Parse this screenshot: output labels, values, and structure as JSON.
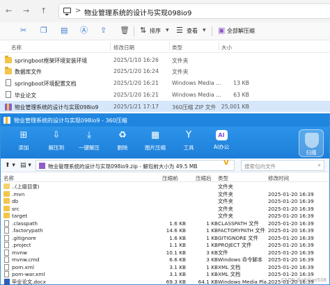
{
  "explorer": {
    "address": {
      "separator": ">",
      "crumb": "物业管理系统的设计与实现098io9"
    },
    "toolbar": {
      "sort_label": "排序",
      "view_label": "查看",
      "extract_all_label": "全部解压缩",
      "icons": [
        "cut-icon",
        "copy-icon",
        "paste-icon",
        "rename-icon",
        "share-icon",
        "delete-icon"
      ]
    },
    "columns": {
      "name": "名称",
      "date": "修改日期",
      "type": "类型",
      "size": "大小"
    },
    "rows": [
      {
        "icon": "folder",
        "name": "springboot框架环境安装环境",
        "date": "2025/1/10 16:26",
        "type": "文件夹",
        "size": ""
      },
      {
        "icon": "folder",
        "name": "数据库文件",
        "date": "2025/1/20 16:24",
        "type": "文件夹",
        "size": ""
      },
      {
        "icon": "doc",
        "name": "springboot环境配置文档",
        "date": "2025/1/20 16:21",
        "type": "Windows Media ...",
        "size": "13 KB"
      },
      {
        "icon": "doc",
        "name": "毕业论文",
        "date": "2025/1/20 16:21",
        "type": "Windows Media ...",
        "size": "63 KB"
      },
      {
        "icon": "zip",
        "name": "物业管理系统的设计与实现098io9",
        "date": "2025/1/21 17:17",
        "type": "360压缩 ZIP 文件",
        "size": "25,001 KB",
        "selected": true
      }
    ]
  },
  "zip": {
    "title": "物业管理系统的设计与实现098io9 - 360压缩",
    "ribbon": [
      {
        "label": "添加",
        "icon": "add-icon"
      },
      {
        "label": "解压到",
        "icon": "extract-to-icon"
      },
      {
        "label": "一键解压",
        "icon": "one-click-extract-icon"
      },
      {
        "label": "删除",
        "icon": "delete-icon"
      },
      {
        "label": "图片压缩",
        "icon": "image-compress-icon"
      },
      {
        "label": "工具",
        "icon": "tools-icon"
      },
      {
        "label": "AI办公",
        "icon": "ai-icon",
        "badge": "AI"
      }
    ],
    "scan_label": "扫描",
    "path_text": "物业管理系统的设计与实现098io9.zip - 解包前大小为 49.5 MB",
    "search_placeholder": "搜索包内文件",
    "columns": {
      "name": "名称",
      "size": "压缩前",
      "comp": "压缩后",
      "type": "类型",
      "time": "修改时间"
    },
    "rows": [
      {
        "icon": "up",
        "name": "..(上级目录)",
        "size": "",
        "comp": "",
        "type": "文件夹",
        "time": ""
      },
      {
        "icon": "folder",
        "name": ".mvn",
        "size": "",
        "comp": "",
        "type": "文件夹",
        "time": "2025-01-20 16:39"
      },
      {
        "icon": "folder",
        "name": "db",
        "size": "",
        "comp": "",
        "type": "文件夹",
        "time": "2025-01-20 16:39"
      },
      {
        "icon": "folder",
        "name": "src",
        "size": "",
        "comp": "",
        "type": "文件夹",
        "time": "2025-01-20 16:39"
      },
      {
        "icon": "folder",
        "name": "target",
        "size": "",
        "comp": "",
        "type": "文件夹",
        "time": "2025-01-20 16:39"
      },
      {
        "icon": "file",
        "name": ".classpath",
        "size": "1.6 KB",
        "comp": "1 KB",
        "type": "CLASSPATH 文件",
        "time": "2025-01-20 16:39"
      },
      {
        "icon": "file",
        "name": ".factorypath",
        "size": "14.6 KB",
        "comp": "1 KB",
        "type": "FACTORYPATH 文件",
        "time": "2025-01-20 16:39"
      },
      {
        "icon": "file",
        "name": ".gitignore",
        "size": "1.6 KB",
        "comp": "1 KB",
        "type": "GITIGNORE 文件",
        "time": "2025-01-20 16:39"
      },
      {
        "icon": "file",
        "name": ".project",
        "size": "1.1 KB",
        "comp": "1 KB",
        "type": "PROJECT 文件",
        "time": "2025-01-20 16:39"
      },
      {
        "icon": "file",
        "name": "mvnw",
        "size": "10.1 KB",
        "comp": "3 KB",
        "type": "文件",
        "time": "2025-01-20 16:39"
      },
      {
        "icon": "file",
        "name": "mvnw.cmd",
        "size": "6.6 KB",
        "comp": "3 KB",
        "type": "Windows 命令脚本",
        "time": "2025-01-20 16:39"
      },
      {
        "icon": "file",
        "name": "pom.xml",
        "size": "3.1 KB",
        "comp": "1 KB",
        "type": "XML 文档",
        "time": "2025-01-20 16:39"
      },
      {
        "icon": "file",
        "name": "pom-war.xml",
        "size": "3.1 KB",
        "comp": "1 KB",
        "type": "XML 文档",
        "time": "2025-01-20 16:39"
      },
      {
        "icon": "word",
        "name": "毕业论文.docx",
        "size": "69.3 KB",
        "comp": "64.1 KB",
        "type": "Windows Media Pla...",
        "time": "2025-01-20 16:39"
      }
    ],
    "watermark": "CSDN @zhiliao508"
  }
}
